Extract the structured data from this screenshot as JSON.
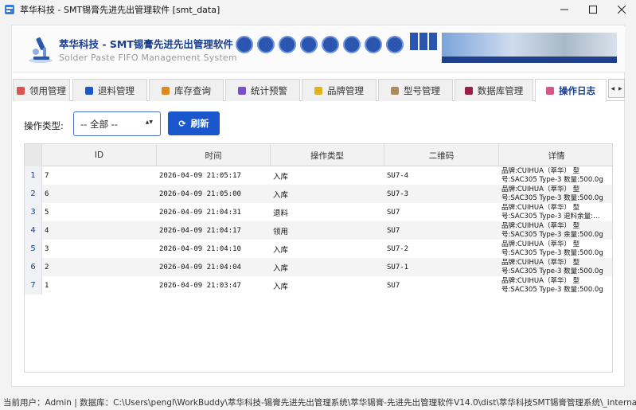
{
  "window": {
    "title": "萃华科技 - SMT锡膏先进先出管理软件 [smt_data]"
  },
  "header": {
    "brand_cn": "萃华科技 - SMT锡膏先进先出管理软件",
    "brand_en": "Solder Paste FIFO Management System"
  },
  "tabs": [
    {
      "label": "领用管理",
      "color": "#d9534f"
    },
    {
      "label": "退料管理",
      "color": "#1a56cc"
    },
    {
      "label": "库存查询",
      "color": "#e08a1e"
    },
    {
      "label": "统计预警",
      "color": "#7a4fc9"
    },
    {
      "label": "品牌管理",
      "color": "#e0b21e"
    },
    {
      "label": "型号管理",
      "color": "#b08a5a"
    },
    {
      "label": "数据库管理",
      "color": "#9a1c4a"
    },
    {
      "label": "操作日志",
      "color": "#d9548a",
      "active": true
    }
  ],
  "filter": {
    "label": "操作类型:",
    "selected": "-- 全部 --",
    "refresh_label": "刷新"
  },
  "table": {
    "columns": [
      "ID",
      "时间",
      "操作类型",
      "二维码",
      "详情"
    ],
    "rows": [
      {
        "num": "1",
        "id": "7",
        "time": "2026-04-09 21:05:17",
        "type": "入库",
        "qr": "SU7-4",
        "detail1": "品牌:CUIHUA（萃华） 型",
        "detail2": "号:SAC305 Type-3 数量:500.0g"
      },
      {
        "num": "2",
        "id": "6",
        "time": "2026-04-09 21:05:00",
        "type": "入库",
        "qr": "SU7-3",
        "detail1": "品牌:CUIHUA（萃华） 型",
        "detail2": "号:SAC305 Type-3 数量:500.0g"
      },
      {
        "num": "3",
        "id": "5",
        "time": "2026-04-09 21:04:31",
        "type": "退料",
        "qr": "SU7",
        "detail1": "品牌:CUIHUA（萃华） 型",
        "detail2": "号:SAC305 Type-3 退料余量:…"
      },
      {
        "num": "4",
        "id": "4",
        "time": "2026-04-09 21:04:17",
        "type": "领用",
        "qr": "SU7",
        "detail1": "品牌:CUIHUA（萃华） 型",
        "detail2": "号:SAC305 Type-3 余量:500.0g"
      },
      {
        "num": "5",
        "id": "3",
        "time": "2026-04-09 21:04:10",
        "type": "入库",
        "qr": "SU7-2",
        "detail1": "品牌:CUIHUA（萃华） 型",
        "detail2": "号:SAC305 Type-3 数量:500.0g"
      },
      {
        "num": "6",
        "id": "2",
        "time": "2026-04-09 21:04:04",
        "type": "入库",
        "qr": "SU7-1",
        "detail1": "品牌:CUIHUA（萃华） 型",
        "detail2": "号:SAC305 Type-3 数量:500.0g"
      },
      {
        "num": "7",
        "id": "1",
        "time": "2026-04-09 21:03:47",
        "type": "入库",
        "qr": "SU7",
        "detail1": "品牌:CUIHUA（萃华） 型",
        "detail2": "号:SAC305 Type-3 数量:500.0g"
      }
    ]
  },
  "statusbar": {
    "text": "当前用户：Admin | 数据库：C:\\Users\\pengl\\WorkBuddy\\萃华科技-锡膏先进先出管理系统\\萃华锡膏-先进先出管理软件V14.0\\dist\\萃华科技SMT锡膏管理系统\\_internal\\smt_data.db"
  }
}
